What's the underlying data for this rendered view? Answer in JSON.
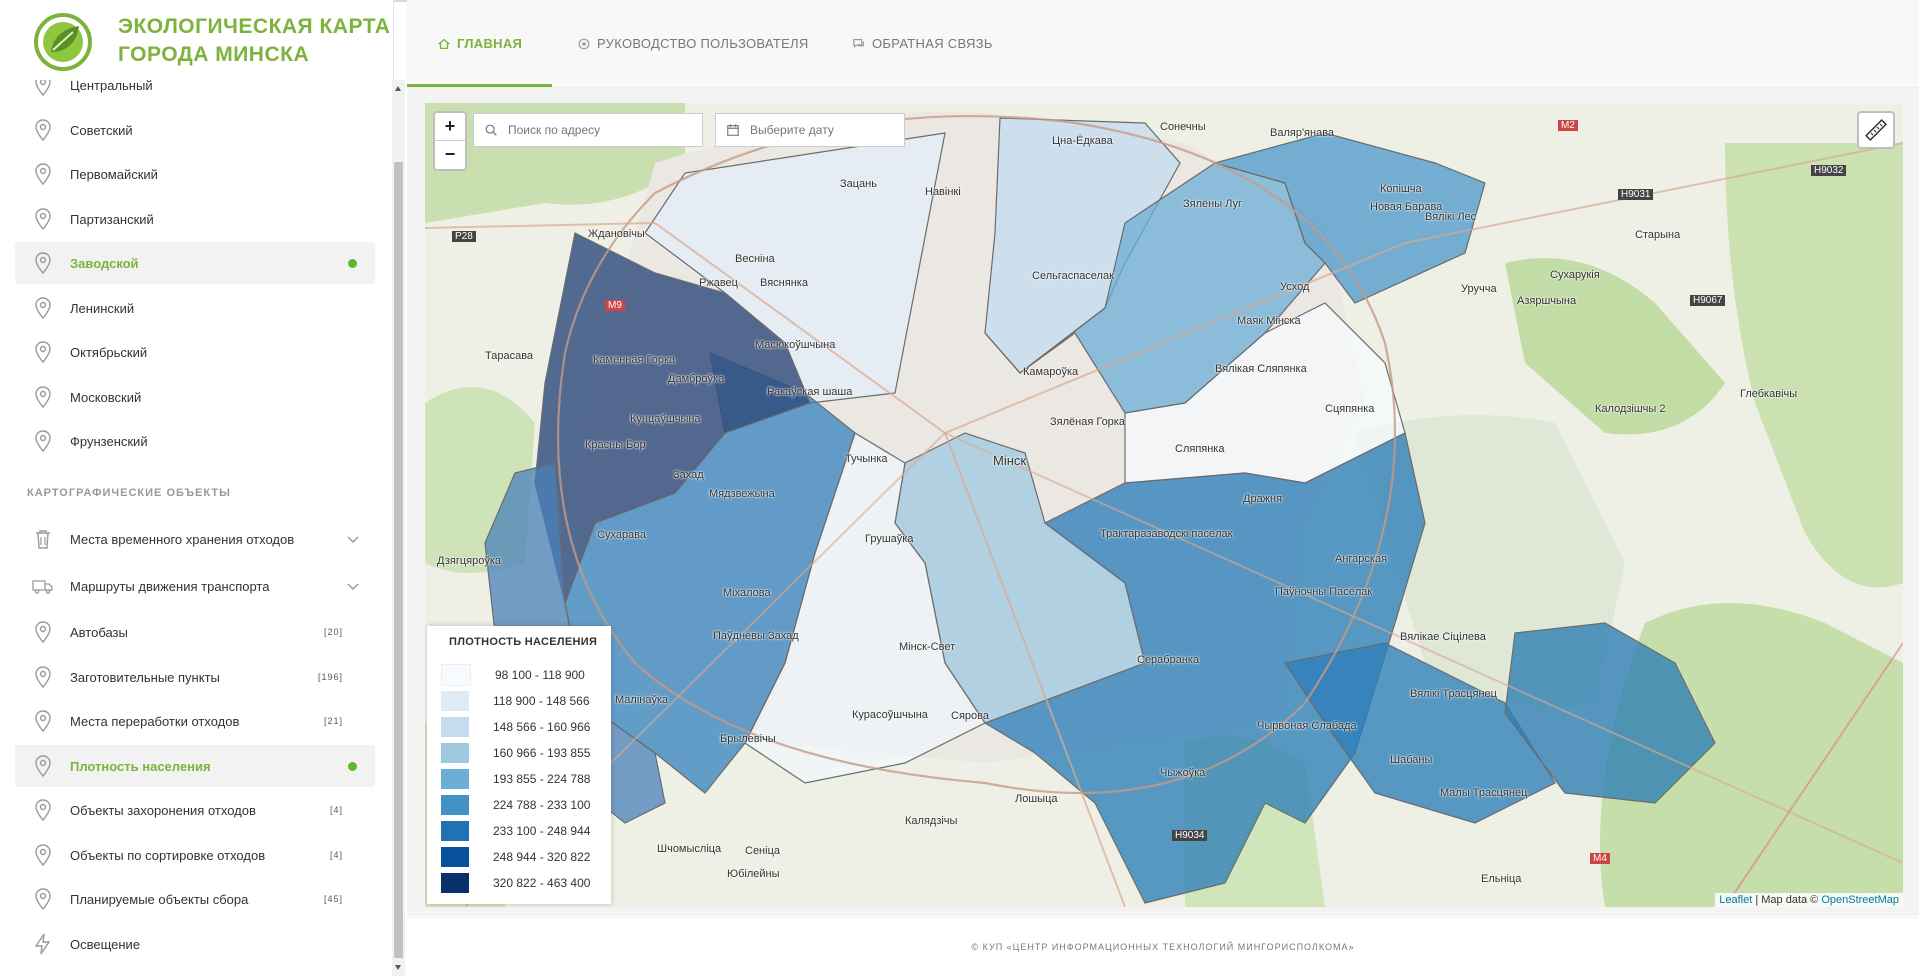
{
  "app": {
    "title_line1": "ЭКОЛОГИЧЕСКАЯ КАРТА",
    "title_line2": "ГОРОДА МИНСКА"
  },
  "tabs": [
    {
      "label": "ГЛАВНАЯ",
      "icon": "home-icon",
      "active": true
    },
    {
      "label": "РУКОВОДСТВО ПОЛЬЗОВАТЕЛЯ",
      "icon": "book-icon",
      "active": false
    },
    {
      "label": "ОБРАТНАЯ СВЯЗЬ",
      "icon": "chat-icon",
      "active": false
    }
  ],
  "districts": [
    {
      "label": "Центральный",
      "active": false
    },
    {
      "label": "Советский",
      "active": false
    },
    {
      "label": "Первомайский",
      "active": false
    },
    {
      "label": "Партизанский",
      "active": false
    },
    {
      "label": "Заводской",
      "active": true
    },
    {
      "label": "Ленинский",
      "active": false
    },
    {
      "label": "Октябрьский",
      "active": false
    },
    {
      "label": "Московский",
      "active": false
    },
    {
      "label": "Фрунзенский",
      "active": false
    }
  ],
  "section_title": "КАРТОГРАФИЧЕСКИЕ ОБЪЕКТЫ",
  "objects": [
    {
      "label": "Места временного хранения отходов",
      "icon": "trash-icon",
      "expandable": true
    },
    {
      "label": "Маршруты движения транспорта",
      "icon": "truck-icon",
      "expandable": true
    },
    {
      "label": "Автобазы",
      "icon": "pin-icon",
      "count": "[20]"
    },
    {
      "label": "Заготовительные пункты",
      "icon": "pin-icon",
      "count": "[196]"
    },
    {
      "label": "Места переработки отходов",
      "icon": "pin-icon",
      "count": "[21]"
    },
    {
      "label": "Плотность населения",
      "icon": "pin-icon",
      "active": true
    },
    {
      "label": "Объекты захоронения отходов",
      "icon": "pin-icon",
      "count": "[4]"
    },
    {
      "label": "Объекты по сортировке отходов",
      "icon": "pin-icon",
      "count": "[4]"
    },
    {
      "label": "Планируемые объекты сбора",
      "icon": "pin-icon",
      "count": "[45]"
    },
    {
      "label": "Освещение",
      "icon": "lightning-icon"
    }
  ],
  "map": {
    "zoom_in": "+",
    "zoom_out": "−",
    "search_placeholder": "Поиск по адресу",
    "date_placeholder": "Выберите дату",
    "attribution_leaflet": "Leaflet",
    "attribution_sep": " | Map data © ",
    "attribution_osm": "OpenStreetMap",
    "city_label": "Мінск",
    "labels": [
      "Ждановічы",
      "Цна-Ёдкава",
      "Сонечны",
      "Валяр'янава",
      "Копішча",
      "Новая Барава",
      "Зялёны Луг",
      "Вялікі Лес",
      "Сухарукія",
      "Старына",
      "Уручча",
      "Азяршчына",
      "Усход",
      "Маяк Мінска",
      "Сельгаспаселак",
      "Камароўка",
      "Зялёная Горка",
      "Вялікая Сляпянка",
      "Сцяпянка",
      "Сляпянка",
      "Калодзішчы 2",
      "Глебкавічы",
      "Масюкоўшчына",
      "Каменная Горка",
      "Дамброўка",
      "Ракаўская шаша",
      "Кунцаўшчына",
      "Красны Бор",
      "Захад",
      "Мядзвежына",
      "Тучынка",
      "Сухарава",
      "Грушаўка",
      "Міхалова",
      "Паўднёвы Захад",
      "Малінаўка",
      "Брылевічы",
      "Мінск-Свет",
      "Курасоўшчына",
      "Сярова",
      "Трактаразаводскі пасёлак",
      "Ангарская",
      "Паўночны Пасёлак",
      "Серабранка",
      "Чырвоная Слабада",
      "Чыжоўка",
      "Шабаны",
      "Малы Трасцянец",
      "Вялікі Трасцянец",
      "Вялікае Сіцілева",
      "Ельніца",
      "Лошыца",
      "Калядзічы",
      "Сеніца",
      "Юбілейны",
      "Шчомыслiца",
      "Тарасава",
      "Дзягцяроўка",
      "Вяснянка",
      "Ржавец",
      "Зацань",
      "Навінкі",
      "Весніна",
      "Дражня"
    ],
    "roads": [
      "M2",
      "H9031",
      "H9032",
      "H9067",
      "P28",
      "M9",
      "M4",
      "H9034"
    ]
  },
  "legend": {
    "title": "ПЛОТНОСТЬ НАСЕЛЕНИЯ",
    "items": [
      {
        "range": "98 100 - 118 900",
        "color": "#f7fbff"
      },
      {
        "range": "118 900 - 148 566",
        "color": "#deebf7"
      },
      {
        "range": "148 566 - 160 966",
        "color": "#c6dbef"
      },
      {
        "range": "160 966 - 193 855",
        "color": "#9ecae1"
      },
      {
        "range": "193 855 - 224 788",
        "color": "#6baed6"
      },
      {
        "range": "224 788 - 233 100",
        "color": "#4292c6"
      },
      {
        "range": "233 100 - 248 944",
        "color": "#2171b5"
      },
      {
        "range": "248 944 - 320 822",
        "color": "#08519c"
      },
      {
        "range": "320 822 - 463 400",
        "color": "#08306b"
      }
    ]
  },
  "footer": {
    "text": "© КУП «ЦЕНТР ИНФОРМАЦИОННЫХ ТЕХНОЛОГИЙ МИНГОРИСПОЛКОМА»"
  },
  "colors": {
    "accent": "#7db33c",
    "active_dot": "#5cb82e"
  }
}
